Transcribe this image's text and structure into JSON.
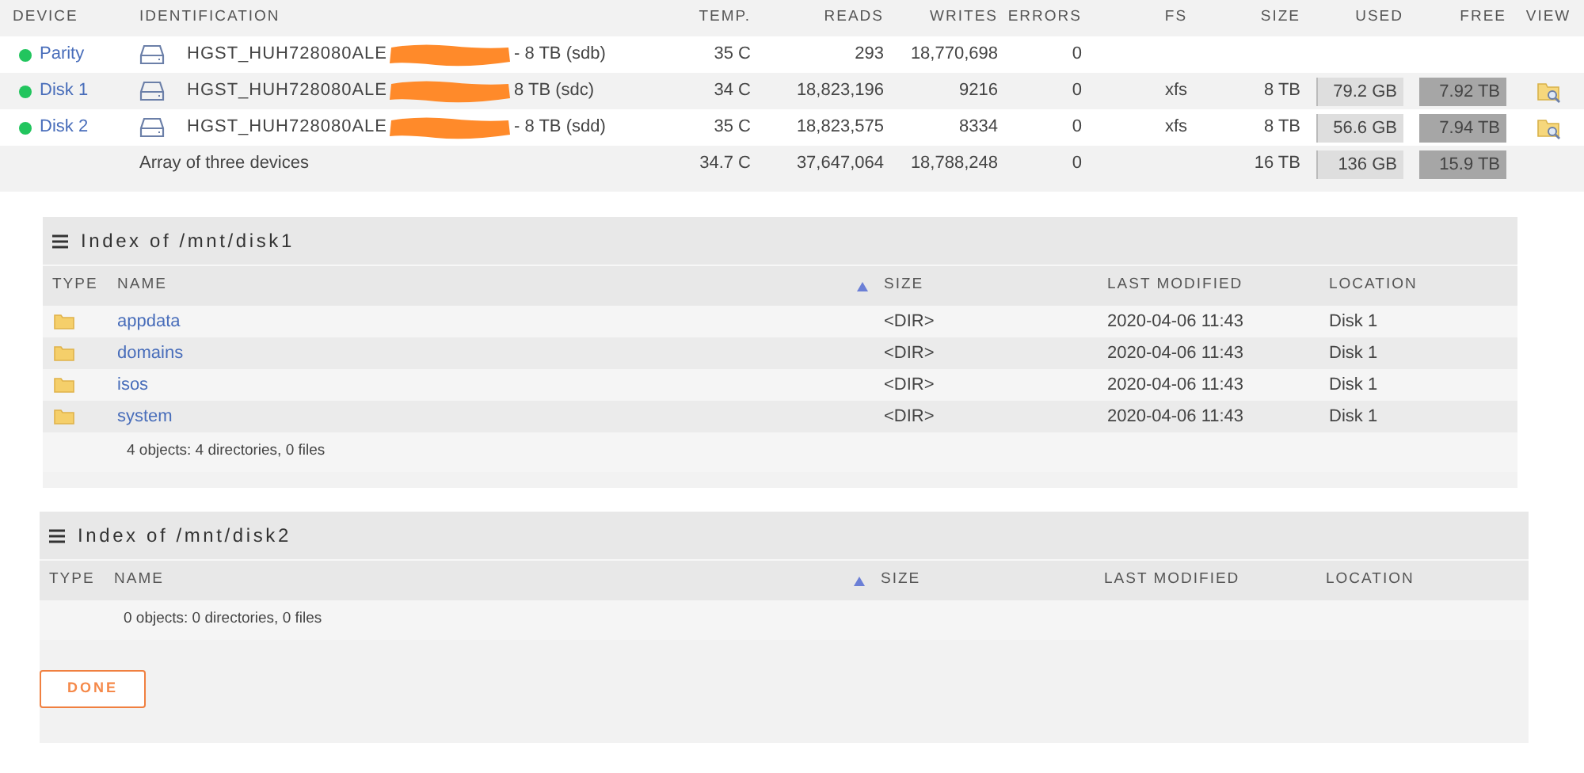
{
  "array": {
    "columns": [
      "DEVICE",
      "IDENTIFICATION",
      "TEMP.",
      "READS",
      "WRITES",
      "ERRORS",
      "FS",
      "SIZE",
      "USED",
      "FREE",
      "VIEW"
    ],
    "rows": [
      {
        "device": "Parity",
        "online": true,
        "id_prefix": "HGST_HUH728080ALE",
        "redacted": true,
        "id_suffix": "- 8 TB (sdb)",
        "temp": "35 C",
        "reads": "293",
        "writes": "18,770,698",
        "errors": "0",
        "view": false
      },
      {
        "device": "Disk 1",
        "online": true,
        "id_prefix": "HGST_HUH728080ALE",
        "redacted": true,
        "id_suffix": "8 TB (sdc)",
        "temp": "34 C",
        "reads": "18,823,196",
        "writes": "9216",
        "errors": "0",
        "fs": "xfs",
        "size": "8 TB",
        "used": "79.2 GB",
        "free": "7.92 TB",
        "view": true
      },
      {
        "device": "Disk 2",
        "online": true,
        "id_prefix": "HGST_HUH728080ALE",
        "redacted": true,
        "id_suffix": "- 8 TB (sdd)",
        "temp": "35 C",
        "reads": "18,823,575",
        "writes": "8334",
        "errors": "0",
        "fs": "xfs",
        "size": "8 TB",
        "used": "56.6 GB",
        "free": "7.94 TB",
        "view": true
      }
    ],
    "total": {
      "label": "Array of three devices",
      "temp": "34.7 C",
      "reads": "37,647,064",
      "writes": "18,788,248",
      "errors": "0",
      "size": "16 TB",
      "used": "136 GB",
      "free": "15.9 TB"
    }
  },
  "panels": [
    {
      "title": "Index of /mnt/disk1",
      "columns": [
        {
          "label": "TYPE",
          "sorted": false
        },
        {
          "label": "NAME",
          "sorted": true
        },
        {
          "label": "SIZE",
          "sorted": false
        },
        {
          "label": "LAST MODIFIED",
          "sorted": false
        },
        {
          "label": "LOCATION",
          "sorted": false
        }
      ],
      "rows": [
        {
          "name": "appdata",
          "size": "<DIR>",
          "modified": "2020-04-06 11:43",
          "location": "Disk 1"
        },
        {
          "name": "domains",
          "size": "<DIR>",
          "modified": "2020-04-06 11:43",
          "location": "Disk 1"
        },
        {
          "name": "isos",
          "size": "<DIR>",
          "modified": "2020-04-06 11:43",
          "location": "Disk 1"
        },
        {
          "name": "system",
          "size": "<DIR>",
          "modified": "2020-04-06 11:43",
          "location": "Disk 1"
        }
      ],
      "summary": "4 objects: 4 directories, 0 files"
    },
    {
      "title": "Index of /mnt/disk2",
      "columns": [
        {
          "label": "TYPE",
          "sorted": false
        },
        {
          "label": "NAME",
          "sorted": true
        },
        {
          "label": "SIZE",
          "sorted": false
        },
        {
          "label": "LAST MODIFIED",
          "sorted": false
        },
        {
          "label": "LOCATION",
          "sorted": false
        }
      ],
      "summary": "0 objects: 0 directories, 0 files",
      "button": "DONE"
    }
  ]
}
